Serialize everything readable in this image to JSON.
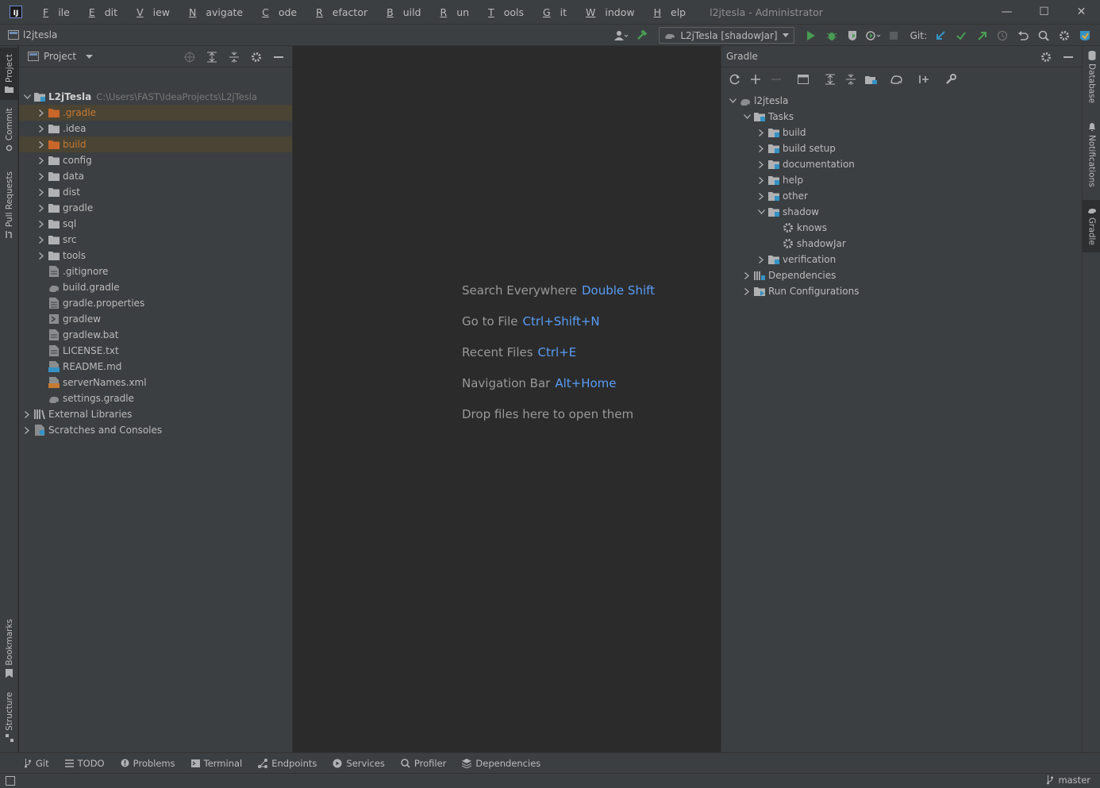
{
  "window": {
    "title": "l2jtesla - Administrator",
    "menu": [
      {
        "m": "F",
        "rest": "ile"
      },
      {
        "m": "E",
        "rest": "dit"
      },
      {
        "m": "V",
        "rest": "iew"
      },
      {
        "m": "N",
        "rest": "avigate"
      },
      {
        "m": "C",
        "rest": "ode"
      },
      {
        "m": "R",
        "rest": "efactor"
      },
      {
        "m": "B",
        "rest": "uild"
      },
      {
        "m": "R",
        "rest": "un"
      },
      {
        "m": "T",
        "rest": "ools"
      },
      {
        "m": "G",
        "rest": "it"
      },
      {
        "m": "W",
        "rest": "indow"
      },
      {
        "m": "H",
        "rest": "elp"
      }
    ]
  },
  "navbar": {
    "project": "l2jtesla",
    "run_config": "L2jTesla [shadowJar]",
    "git_label": "Git:"
  },
  "left_stripe": {
    "project": "Project",
    "commit": "Commit",
    "pull_requests": "Pull Requests",
    "bookmarks": "Bookmarks",
    "structure": "Structure"
  },
  "right_stripe": {
    "database": "Database",
    "notifications": "Notifications",
    "gradle": "Gradle"
  },
  "project_panel": {
    "title": "Project",
    "root": {
      "name": "L2jTesla",
      "path": "C:\\Users\\FAST\\IdeaProjects\\L2jTesla"
    },
    "items": [
      {
        "name": ".gradle",
        "type": "folder",
        "excluded": true
      },
      {
        "name": ".idea",
        "type": "folder"
      },
      {
        "name": "build",
        "type": "folder",
        "excluded": true
      },
      {
        "name": "config",
        "type": "folder"
      },
      {
        "name": "data",
        "type": "folder"
      },
      {
        "name": "dist",
        "type": "folder"
      },
      {
        "name": "gradle",
        "type": "folder"
      },
      {
        "name": "sql",
        "type": "folder"
      },
      {
        "name": "src",
        "type": "folder"
      },
      {
        "name": "tools",
        "type": "folder"
      },
      {
        "name": ".gitignore",
        "type": "file"
      },
      {
        "name": "build.gradle",
        "type": "gradle"
      },
      {
        "name": "gradle.properties",
        "type": "props"
      },
      {
        "name": "gradlew",
        "type": "exec"
      },
      {
        "name": "gradlew.bat",
        "type": "file"
      },
      {
        "name": "LICENSE.txt",
        "type": "file"
      },
      {
        "name": "README.md",
        "type": "md"
      },
      {
        "name": "serverNames.xml",
        "type": "xml"
      },
      {
        "name": "settings.gradle",
        "type": "gradle"
      }
    ],
    "external_libraries": "External Libraries",
    "scratches": "Scratches and Consoles"
  },
  "editor": {
    "hints": [
      {
        "text": "Search Everywhere",
        "key": "Double Shift"
      },
      {
        "text": "Go to File",
        "key": "Ctrl+Shift+N"
      },
      {
        "text": "Recent Files",
        "key": "Ctrl+E"
      },
      {
        "text": "Navigation Bar",
        "key": "Alt+Home"
      },
      {
        "text": "Drop files here to open them",
        "key": ""
      }
    ]
  },
  "gradle_panel": {
    "title": "Gradle",
    "root": "l2jtesla",
    "tasks_label": "Tasks",
    "task_groups": [
      "build",
      "build setup",
      "documentation",
      "help",
      "other",
      "shadow"
    ],
    "shadow_tasks": [
      "knows",
      "shadowJar"
    ],
    "verification": "verification",
    "dependencies": "Dependencies",
    "run_configurations": "Run Configurations"
  },
  "bottom_tabs": [
    "Git",
    "TODO",
    "Problems",
    "Terminal",
    "Endpoints",
    "Services",
    "Profiler",
    "Dependencies"
  ],
  "status": {
    "branch": "master"
  },
  "colors": {
    "accent": "#589df6",
    "excluded": "#c67a32",
    "run": "#499c54",
    "panel": "#3c3f41",
    "editor": "#2b2b2b"
  }
}
